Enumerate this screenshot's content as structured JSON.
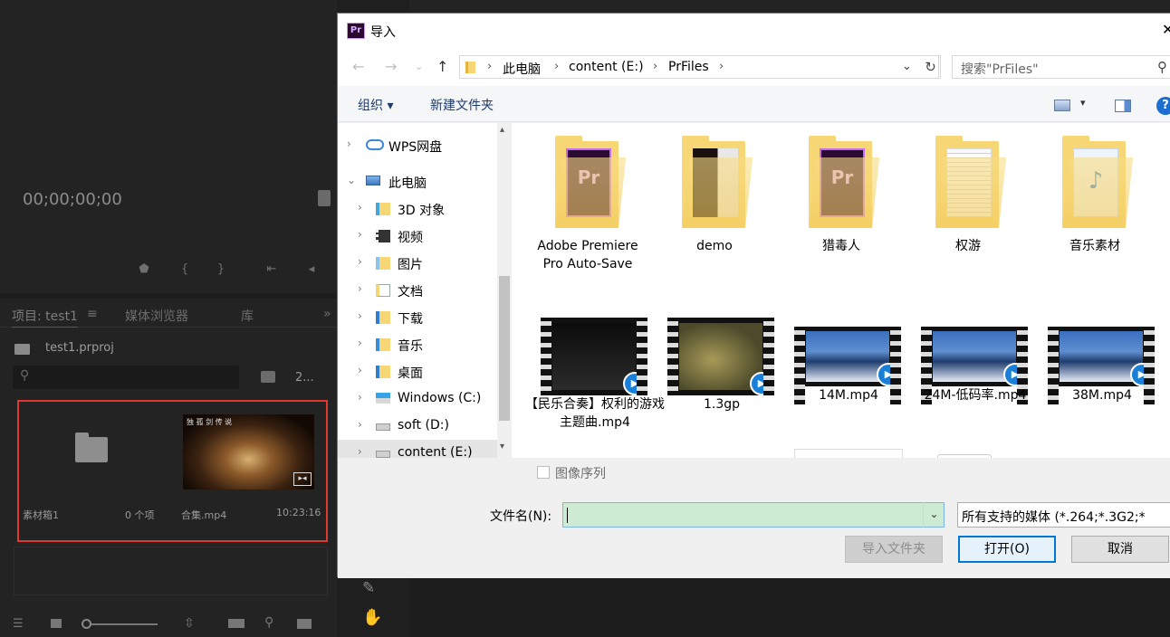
{
  "premiere": {
    "timecode": "00;00;00;00",
    "tabs": [
      "项目: test1",
      "媒体浏览器",
      "库"
    ],
    "tab_menu_glyph": "≡",
    "overflow_glyph": "»",
    "project_file": "test1.prproj",
    "items_count": "2...",
    "bin": {
      "name": "素材箱1",
      "count": "0 个项"
    },
    "clip": {
      "name": "合集.mp4",
      "duration": "10:23:16"
    }
  },
  "dialog": {
    "title": "导入",
    "app_icon_text": "Pr",
    "close_glyph": "✕",
    "breadcrumb": [
      "此电脑",
      "content (E:)",
      "PrFiles"
    ],
    "search_placeholder": "搜索\"PrFiles\"",
    "toolbar": {
      "organize": "组织 ▾",
      "new_folder": "新建文件夹",
      "help": "?"
    },
    "nav_items": [
      {
        "label": "WPS网盘",
        "icon": "cloud-icon"
      },
      {
        "label": "此电脑",
        "icon": "computer-icon"
      },
      {
        "label": "3D 对象",
        "icon": "folder-3d-icon"
      },
      {
        "label": "视频",
        "icon": "video-folder-icon"
      },
      {
        "label": "图片",
        "icon": "pictures-folder-icon"
      },
      {
        "label": "文档",
        "icon": "documents-folder-icon"
      },
      {
        "label": "下载",
        "icon": "downloads-folder-icon"
      },
      {
        "label": "音乐",
        "icon": "music-folder-icon"
      },
      {
        "label": "桌面",
        "icon": "desktop-folder-icon"
      },
      {
        "label": "Windows (C:)",
        "icon": "windows-drive-icon"
      },
      {
        "label": "soft (D:)",
        "icon": "drive-icon"
      },
      {
        "label": "content (E:)",
        "icon": "drive-icon"
      }
    ],
    "files": [
      {
        "label": "Adobe Premiere Pro Auto-Save",
        "kind": "folder",
        "accent": "#8a2aa8"
      },
      {
        "label": "demo",
        "kind": "folder",
        "accent": "#2a2a2a"
      },
      {
        "label": "猎毒人",
        "kind": "folder",
        "accent": "#8a2aa8"
      },
      {
        "label": "权游",
        "kind": "folder",
        "accent": "#f2f2f2"
      },
      {
        "label": "音乐素材",
        "kind": "folder",
        "accent": "#e8f0fb"
      },
      {
        "label": "【民乐合奏】权利的游戏主题曲.mp4",
        "kind": "video",
        "accent": "#1a1a1a"
      },
      {
        "label": "1.3gp",
        "kind": "video",
        "accent": "#8a7a3a"
      },
      {
        "label": "14M.mp4",
        "kind": "video",
        "accent": "#2c4f8a"
      },
      {
        "label": "24M-低码率.mp4",
        "kind": "video",
        "accent": "#2c4f8a"
      },
      {
        "label": "38M.mp4",
        "kind": "video",
        "accent": "#2c4f8a"
      }
    ],
    "image_sequence_label": "图像序列",
    "file_name_label": "文件名(N):",
    "file_name_value": "",
    "file_type": "所有支持的媒体 (*.264;*.3G2;*",
    "buttons": {
      "import_folder": "导入文件夹",
      "open": "打开(O)",
      "cancel": "取消"
    }
  }
}
